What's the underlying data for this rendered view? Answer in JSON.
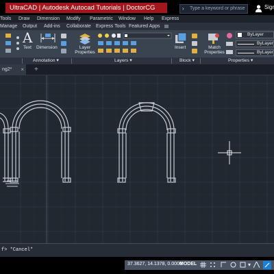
{
  "titlebar": {
    "video_title": "UltraCAD | Autodesk Autocad Tutorials  |  DoctorCG",
    "search_placeholder": "Type a keyword or phrase",
    "signin_label": "Sign"
  },
  "menubar": {
    "items": [
      "Tools",
      "Draw",
      "Dimension",
      "Modify",
      "Parametric",
      "Window",
      "Help",
      "Express"
    ]
  },
  "ribbon_tabs": {
    "items": [
      "Manage",
      "Output",
      "Add-ins",
      "Collaborate",
      "Express Tools",
      "Featured Apps"
    ]
  },
  "ribbon": {
    "text_label": "Text",
    "dimension_label": "Dimension",
    "layer_properties_label": "Layer Properties",
    "insert_label": "Insert",
    "match_properties_label": "Match Properties",
    "bylayer_1": "ByLayer",
    "bylayer_2": "ByLayer",
    "bylayer_3": "ByLayer"
  },
  "panels": {
    "annotation": "Annotation ▾",
    "layers": "Layers ▾",
    "block": "Block ▾",
    "properties": "Properties ▾"
  },
  "doctabs": {
    "active_tab": "ng2*"
  },
  "cmdline": {
    "text": "f> *Cancel*"
  },
  "statusbar": {
    "coords": "37.3627, 14.1378, 0.0000",
    "model_label": "MODEL"
  },
  "colors": {
    "title_red": "#a3161c",
    "canvas_bg": "#212830",
    "ribbon_bg": "#3a4350",
    "accent_blue": "#1a7fd6"
  }
}
